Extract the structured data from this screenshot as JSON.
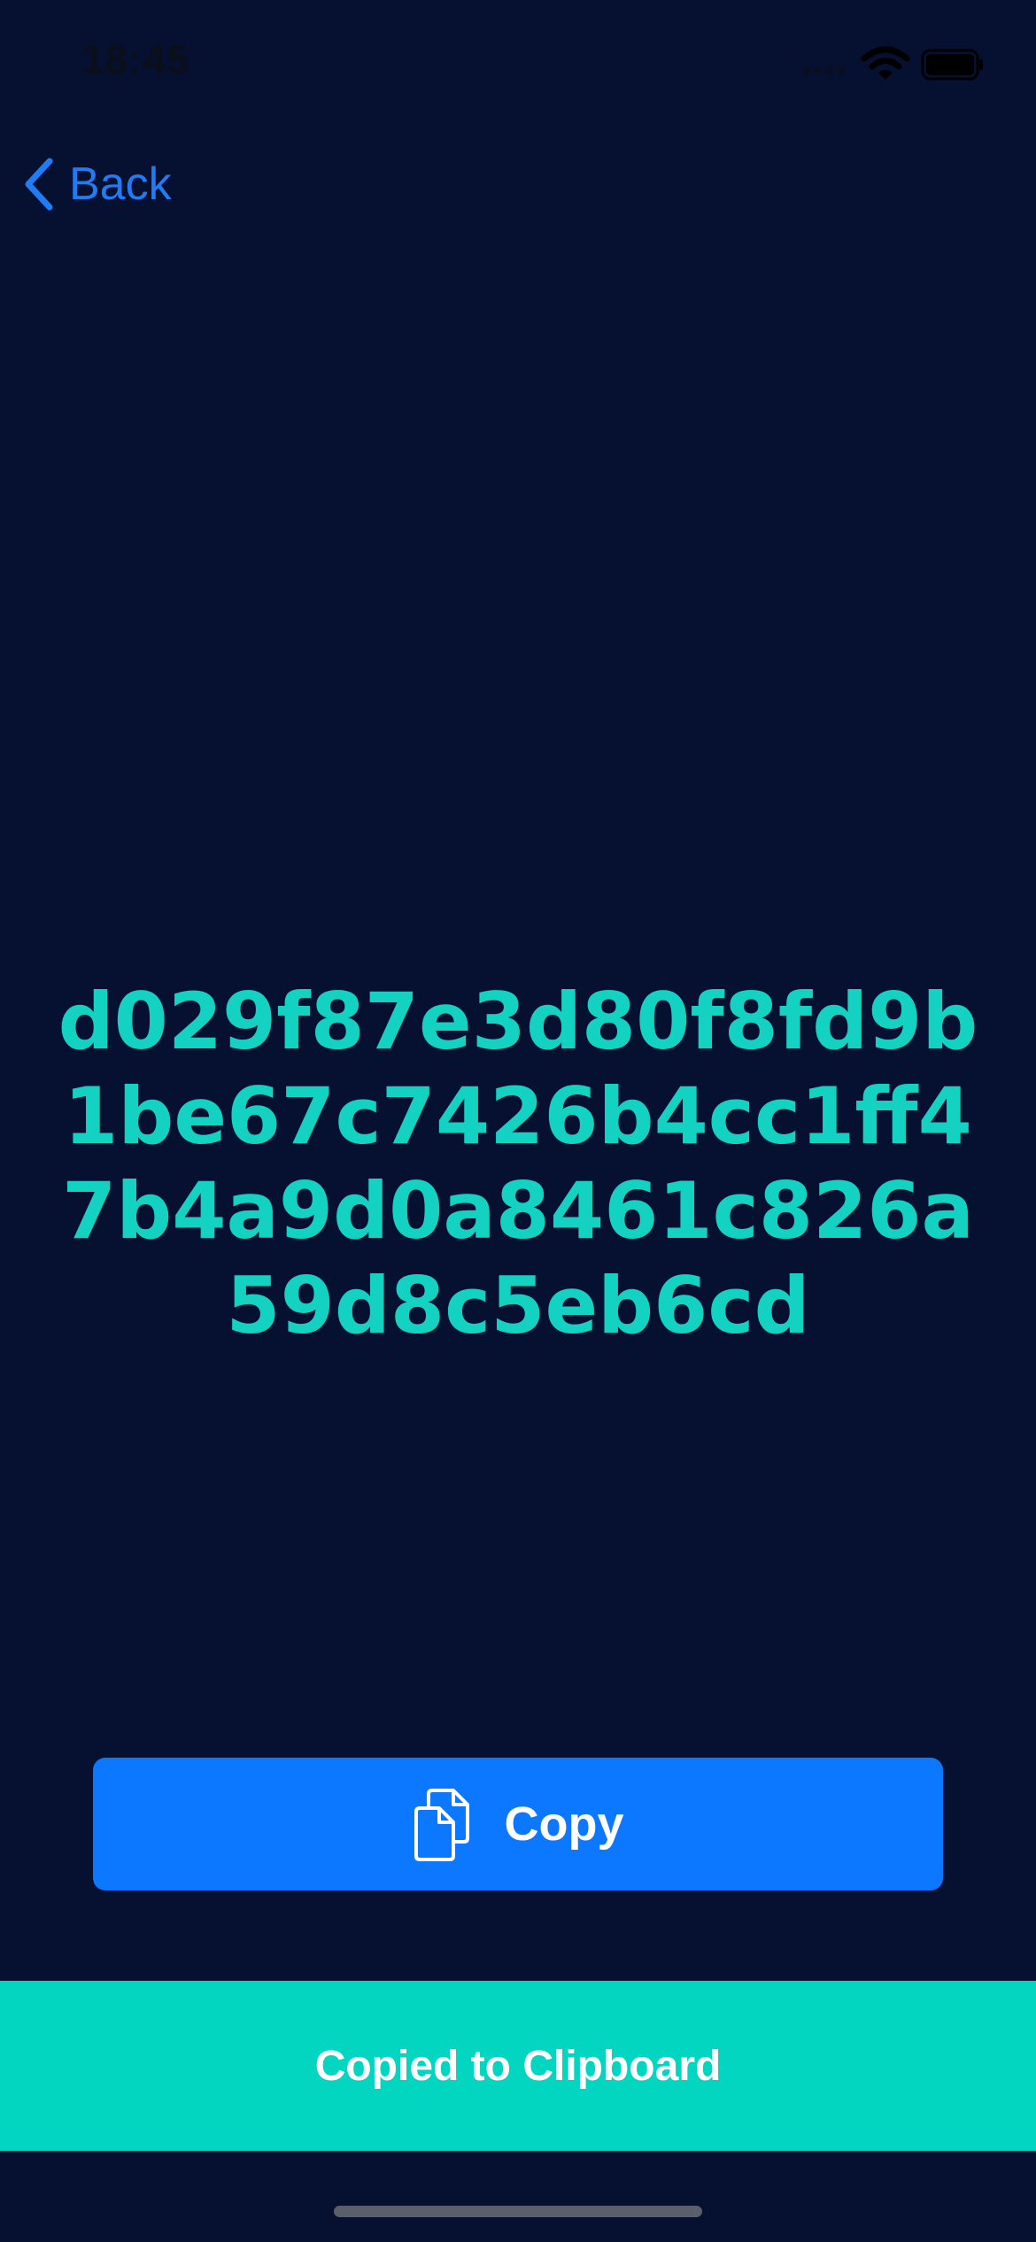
{
  "status_bar": {
    "time": "18:45"
  },
  "nav": {
    "back_label": "Back"
  },
  "hash": {
    "value": "d029f87e3d80f8fd9b1be67c7426b4cc1ff47b4a9d0a8461c826a59d8c5eb6cd"
  },
  "copy_button": {
    "label": "Copy",
    "icon": "documents-icon"
  },
  "toast": {
    "message": "Copied to Clipboard"
  },
  "colors": {
    "background": "#061030",
    "accent_blue": "#0b78ff",
    "hash_teal": "#13d2c2",
    "toast_teal": "#02d6c1"
  }
}
